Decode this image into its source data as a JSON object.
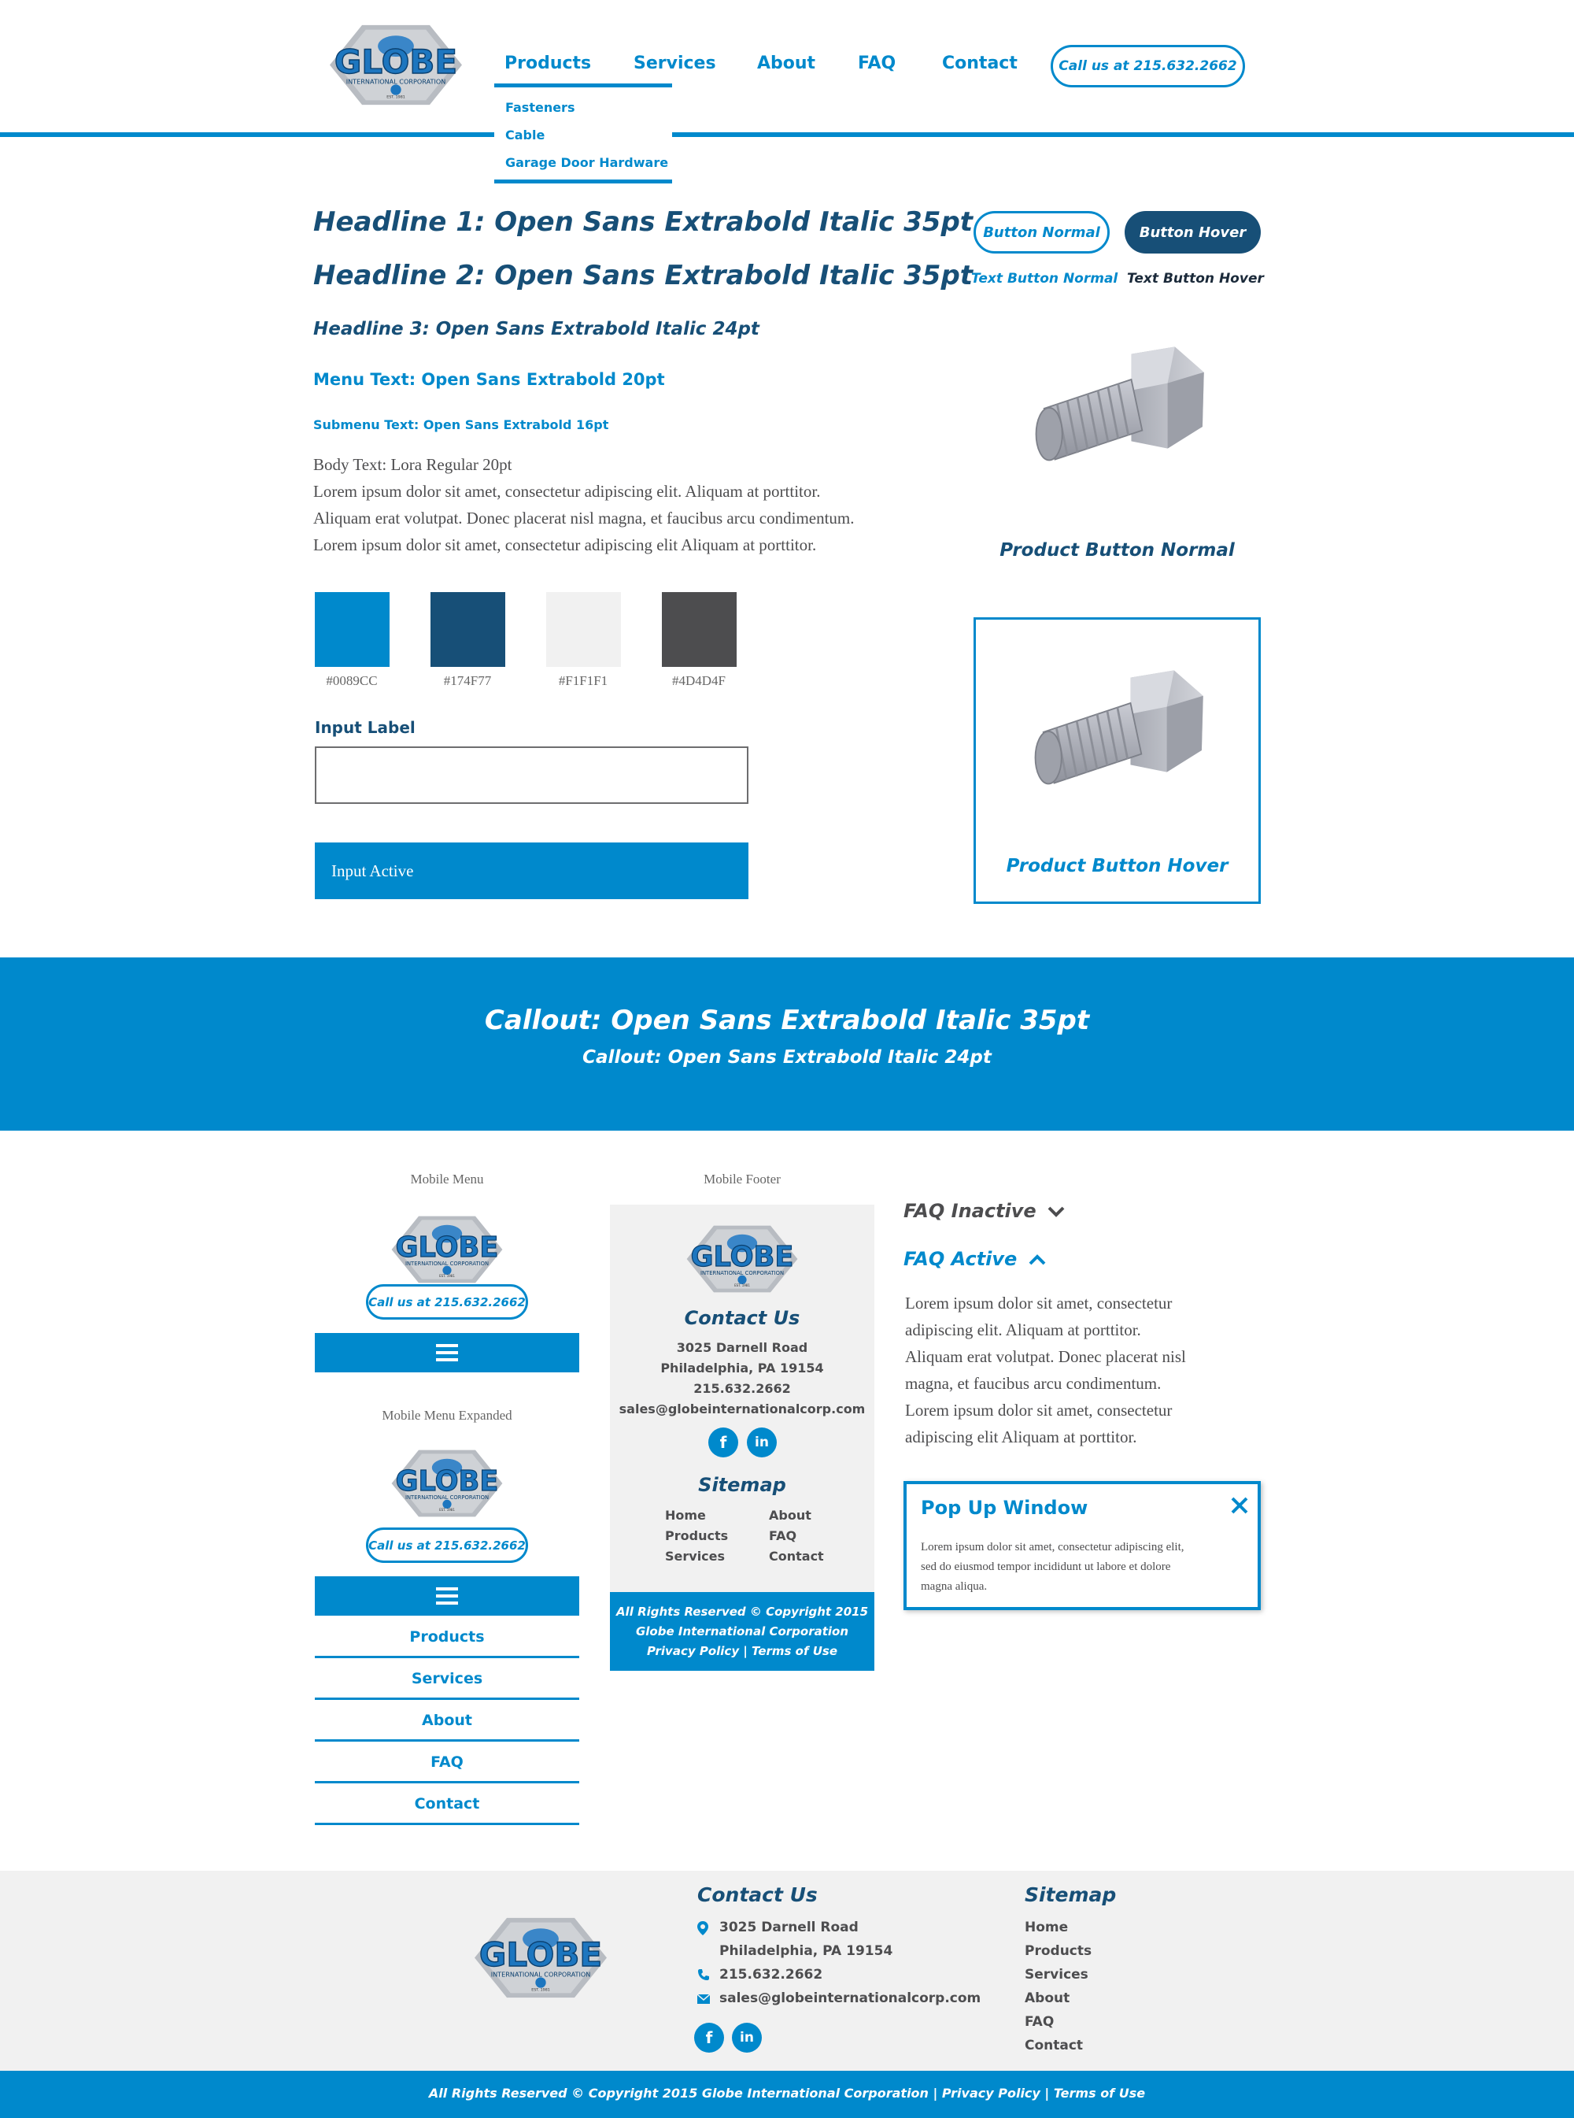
{
  "header": {
    "logo_text": "GLOBE",
    "logo_subtext": "INTERNATIONAL CORPORATION",
    "logo_est": "EST. 1981",
    "nav": [
      "Products",
      "Services",
      "About",
      "FAQ",
      "Contact"
    ],
    "call_button": "Call us at 215.632.2662",
    "submenu": [
      "Fasteners",
      "Cable",
      "Garage Door Hardware"
    ]
  },
  "styleguide": {
    "h1": "Headline 1: Open Sans Extrabold Italic 35pt",
    "h2": "Headline 2: Open Sans Extrabold Italic 35pt",
    "h3": "Headline 3: Open Sans Extrabold Italic 24pt",
    "menu_text": "Menu Text: Open Sans Extrabold 20pt",
    "submenu_text": "Submenu Text: Open Sans Extrabold 16pt",
    "body_label": "Body Text: Lora Regular 20pt",
    "body_lines": [
      "Lorem ipsum dolor sit amet, consectetur adipiscing elit. Aliquam at porttitor.",
      "Aliquam erat volutpat. Donec placerat nisl magna, et faucibus arcu condimentum.",
      "Lorem ipsum dolor sit amet, consectetur adipiscing elit Aliquam at porttitor."
    ],
    "swatches": [
      {
        "hex": "#0089CC",
        "label": "#0089CC"
      },
      {
        "hex": "#174F77",
        "label": "#174F77"
      },
      {
        "hex": "#F1F1F1",
        "label": "#F1F1F1"
      },
      {
        "hex": "#4D4D4F",
        "label": "#4D4D4F"
      }
    ],
    "input_label": "Input Label",
    "input_active": "Input Active",
    "button_normal": "Button Normal",
    "button_hover": "Button Hover",
    "text_button_normal": "Text Button Normal",
    "text_button_hover": "Text Button Hover",
    "product_normal": "Product Button Normal",
    "product_hover": "Product Button Hover"
  },
  "callout": {
    "title": "Callout: Open Sans Extrabold Italic 35pt",
    "subtitle": "Callout: Open Sans Extrabold Italic 24pt"
  },
  "mobile": {
    "menu_title": "Mobile Menu",
    "menu_expanded_title": "Mobile Menu Expanded",
    "footer_title": "Mobile Footer",
    "call_button": "Call us at 215.632.2662",
    "menu_items": [
      "Products",
      "Services",
      "About",
      "FAQ",
      "Contact"
    ],
    "contact_heading": "Contact Us",
    "address1": "3025 Darnell Road",
    "address2": "Philadelphia, PA 19154",
    "phone": "215.632.2662",
    "email": "sales@globeinternationalcorp.com",
    "sitemap_heading": "Sitemap",
    "sitemap_col1": [
      "Home",
      "Products",
      "Services"
    ],
    "sitemap_col2": [
      "About",
      "FAQ",
      "Contact"
    ],
    "copyright1": "All Rights Reserved © Copyright 2015",
    "copyright2": "Globe International Corporation",
    "copyright3": "Privacy Policy | Terms of Use"
  },
  "faq": {
    "inactive": "FAQ Inactive",
    "active": "FAQ Active",
    "answer_lines": [
      "Lorem ipsum dolor sit amet, consectetur",
      "adipiscing elit. Aliquam at porttitor.",
      "Aliquam erat volutpat. Donec placerat nisl",
      "magna, et faucibus arcu condimentum.",
      "Lorem ipsum dolor sit amet, consectetur",
      "adipiscing elit Aliquam at porttitor."
    ]
  },
  "popup": {
    "title": "Pop Up Window",
    "lines": [
      "Lorem ipsum dolor sit amet, consectetur adipiscing elit,",
      "sed do eiusmod tempor incididunt ut labore et dolore",
      "magna aliqua."
    ]
  },
  "footer": {
    "contact_heading": "Contact Us",
    "address1": "3025 Darnell Road",
    "address2": "Philadelphia, PA 19154",
    "phone": "215.632.2662",
    "email": "sales@globeinternationalcorp.com",
    "sitemap_heading": "Sitemap",
    "sitemap": [
      "Home",
      "Products",
      "Services",
      "About",
      "FAQ",
      "Contact"
    ],
    "copyright": "All Rights Reserved © Copyright 2015 Globe International Corporation | Privacy Policy | Terms of Use"
  },
  "icons": {
    "facebook": "f",
    "linkedin": "in"
  }
}
